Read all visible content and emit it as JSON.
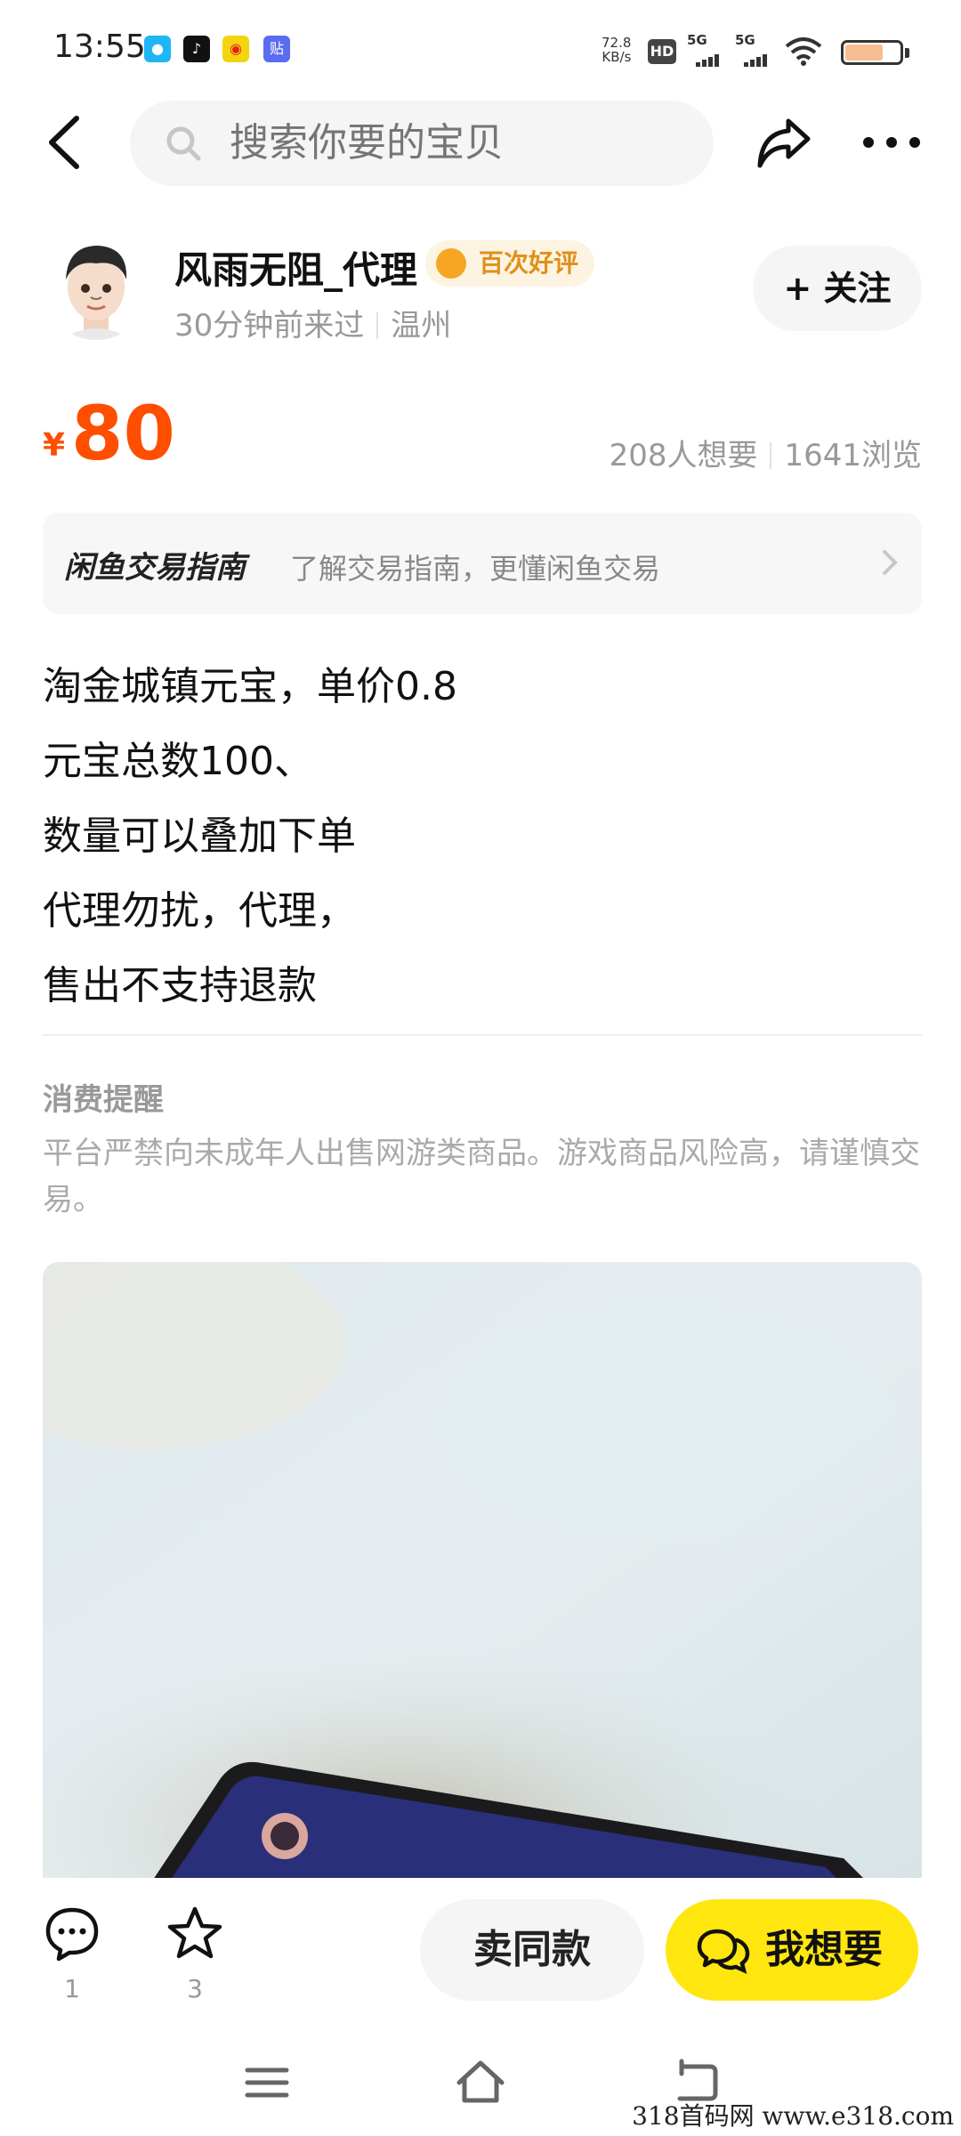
{
  "status_bar": {
    "time": "13:55",
    "net_speed_value": "72.8",
    "net_speed_unit": "KB/s",
    "hd_label": "HD",
    "sim1": "5G",
    "sim2": "5G",
    "app_icons": [
      "qq-icon",
      "tiktok-icon",
      "weibo-icon",
      "tieba-icon"
    ],
    "battery_color": "#f4bd94"
  },
  "header": {
    "search_placeholder": "搜索你要的宝贝"
  },
  "seller": {
    "name": "风雨无阻_代理",
    "badge": "百次好评",
    "last_seen": "30分钟前来过",
    "location": "温州",
    "follow_label": "+ 关注"
  },
  "price": {
    "currency": "¥",
    "value": "80",
    "wants": "208人想要",
    "views": "1641浏览",
    "color": "#ff4e00"
  },
  "guide": {
    "title": "闲鱼交易指南",
    "description": "了解交易指南，更懂闲鱼交易"
  },
  "description_lines": [
    "淘金城镇元宝，单价0.8",
    "元宝总数100、",
    "数量可以叠加下单",
    "代理勿扰，代理，",
    "售出不支持退款"
  ],
  "notice": {
    "title": "消费提醒",
    "text": "平台严禁向未成年人出售网游类商品。游戏商品风险高，请谨慎交易。"
  },
  "actions": {
    "comments_count": "1",
    "favorites_count": "3",
    "same_item_label": "卖同款",
    "want_label": "我想要",
    "accent": "#ffe60f"
  },
  "watermark": "318首码网  www.e318.com"
}
